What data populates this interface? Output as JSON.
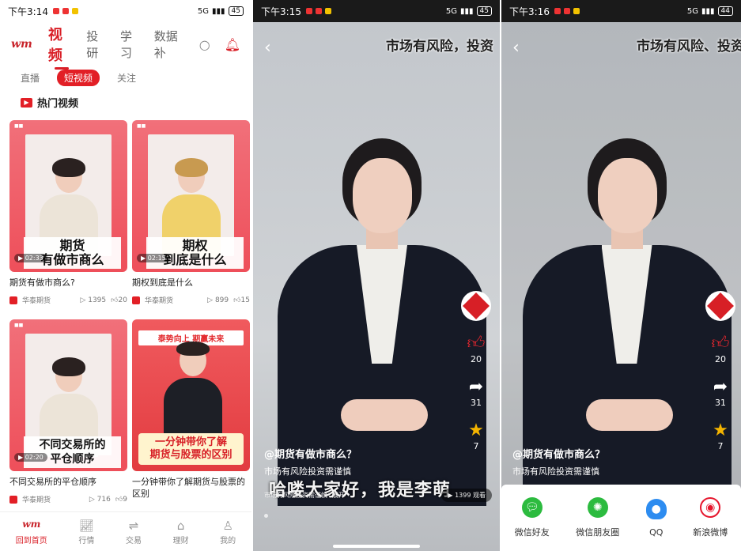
{
  "panel1": {
    "status": {
      "time": "下午3:14",
      "signal": "5G",
      "battery": "45"
    },
    "logo": "WM",
    "top_tabs": [
      "视频",
      "投研",
      "学习",
      "数据",
      "数据补"
    ],
    "top_tabs_visible": [
      "视频",
      "投研",
      "学习",
      "数据补"
    ],
    "sub_tabs": [
      "直播",
      "短视频",
      "关注"
    ],
    "section_title": "热门视频",
    "cards": [
      {
        "caption": "期货\n有做市商么",
        "caption_l1": "期货",
        "caption_l2": "有做市商么",
        "duration": "02:33",
        "title": "期货有做市商么?",
        "publisher": "华泰期货",
        "views": "1395",
        "likes": "20"
      },
      {
        "caption_l1": "期权",
        "caption_l2": "到底是什么",
        "duration": "02:15",
        "title": "期权到底是什么",
        "publisher": "华泰期货",
        "views": "899",
        "likes": "15"
      },
      {
        "caption_l1": "不同交易所的",
        "caption_l2": "平仓顺序",
        "duration": "02:20",
        "title": "不同交易所的平仓顺序",
        "publisher": "华泰期货",
        "views": "716",
        "likes": "9"
      },
      {
        "promo_top": "泰势向上 期赢未来",
        "caption_l1": "一分钟带你了解",
        "caption_l2": "期货与股票的区别",
        "title": "一分钟带你了解期货与股票的区别"
      }
    ],
    "bottom_nav": [
      {
        "label": "回到首页",
        "icon": "WM"
      },
      {
        "label": "行情",
        "icon": "⩘"
      },
      {
        "label": "交易",
        "icon": "⇌"
      },
      {
        "label": "理财",
        "icon": "⌂"
      },
      {
        "label": "我的",
        "icon": "♙"
      }
    ]
  },
  "panel2": {
    "status": {
      "time": "下午3:15",
      "signal": "5G",
      "battery": "45"
    },
    "top_overlay": "市场有风险，投资",
    "handle": "@期货有做市商么？",
    "desc": "市场有风险投资需谨慎",
    "subtitle": "哈喽大家好，我是李萌",
    "footer_desc": "市场有风险投资需谨慎",
    "expand": "展开",
    "views": "1399 观看",
    "actions": {
      "likes": "20",
      "shares": "31",
      "favorites": "7"
    }
  },
  "panel3": {
    "status": {
      "time": "下午3:16",
      "signal": "5G",
      "battery": "44"
    },
    "top_overlay": "市场有风险、投资",
    "handle": "@期货有做市商么？",
    "desc": "市场有风险投资需谨慎",
    "actions": {
      "likes": "20",
      "shares": "31",
      "favorites": "7"
    },
    "share_options": [
      "微信好友",
      "微信朋友圈",
      "QQ",
      "新浪微博"
    ]
  }
}
